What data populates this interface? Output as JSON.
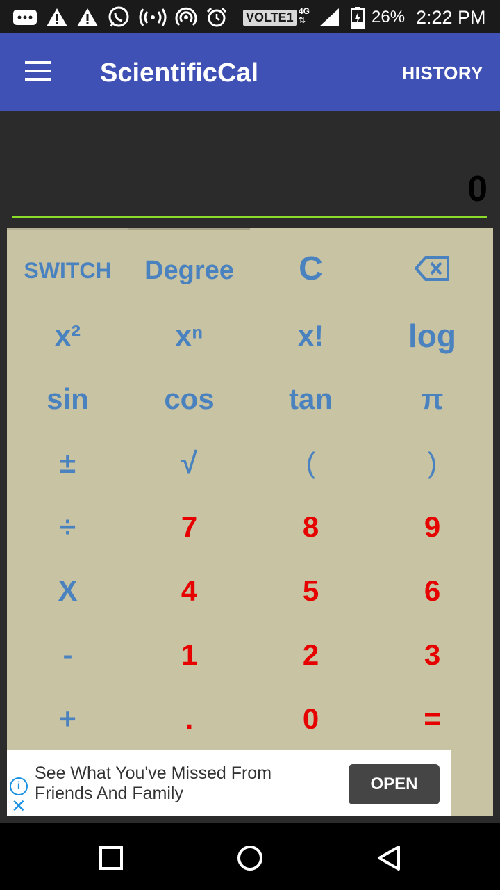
{
  "status_bar": {
    "network_label": "VOLTE",
    "sim_slot": "1",
    "network_type": "4G",
    "battery_percent": "26%",
    "time": "2:22 PM"
  },
  "app_bar": {
    "title": "ScientificCal",
    "history_label": "HISTORY"
  },
  "display": {
    "value": "0"
  },
  "keypad": {
    "rows": [
      [
        "SWITCH",
        "Degree",
        "C",
        "backspace"
      ],
      [
        "x²",
        "xⁿ",
        "x!",
        "log"
      ],
      [
        "sin",
        "cos",
        "tan",
        "π"
      ],
      [
        "±",
        "√",
        "(",
        ")"
      ],
      [
        "÷",
        "7",
        "8",
        "9"
      ],
      [
        "X",
        "4",
        "5",
        "6"
      ],
      [
        "-",
        "1",
        "2",
        "3"
      ],
      [
        "+",
        ".",
        "0",
        "="
      ]
    ]
  },
  "ad": {
    "text": "See What You've Missed From Friends And Family",
    "button_label": "OPEN"
  },
  "colors": {
    "app_bar": "#3f51b5",
    "keypad_bg": "#c8c3a3",
    "function_key": "#4a82bf",
    "digit_key": "#e60000",
    "display_underline": "#8bdb2a"
  }
}
